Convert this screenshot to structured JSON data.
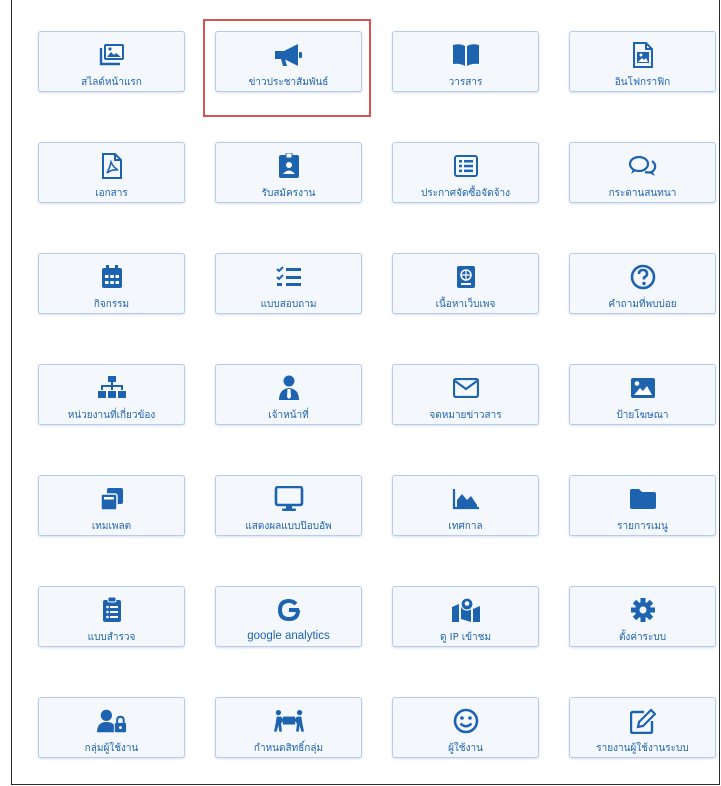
{
  "accent_color": "#1e63b0",
  "highlight_color": "#d9534f",
  "tiles": [
    {
      "label": "สไลด์หน้าแรก",
      "icon": "images-icon"
    },
    {
      "label": "ข่าวประชาสัมพันธ์",
      "icon": "megaphone-icon",
      "highlighted": true
    },
    {
      "label": "วารสาร",
      "icon": "book-open-icon"
    },
    {
      "label": "อินโฟกราฟิก",
      "icon": "file-image-icon"
    },
    {
      "label": "เอกสาร",
      "icon": "file-pdf-icon"
    },
    {
      "label": "รับสมัครงาน",
      "icon": "id-badge-icon"
    },
    {
      "label": "ประกาศจัดซื้อจัดจ้าง",
      "icon": "list-alt-icon"
    },
    {
      "label": "กระดานสนทนา",
      "icon": "comments-icon"
    },
    {
      "label": "กิจกรรม",
      "icon": "calendar-icon"
    },
    {
      "label": "แบบสอบถาม",
      "icon": "tasks-icon"
    },
    {
      "label": "เนื้อหาเว็บเพจ",
      "icon": "passport-icon"
    },
    {
      "label": "คำถามที่พบบ่อย",
      "icon": "question-circle-icon"
    },
    {
      "label": "หน่วยงานที่เกี่ยวข้อง",
      "icon": "sitemap-icon"
    },
    {
      "label": "เจ้าหน้าที่",
      "icon": "user-tie-icon"
    },
    {
      "label": "จดหมายข่าวสาร",
      "icon": "envelope-icon"
    },
    {
      "label": "ป้ายโฆษณา",
      "icon": "image-icon"
    },
    {
      "label": "เทมเพลต",
      "icon": "clone-icon"
    },
    {
      "label": "แสดงผลแบบป๊อบอัพ",
      "icon": "desktop-icon"
    },
    {
      "label": "เทศกาล",
      "icon": "chart-area-icon"
    },
    {
      "label": "รายการเมนู",
      "icon": "folder-icon"
    },
    {
      "label": "แบบสำรวจ",
      "icon": "clipboard-list-icon"
    },
    {
      "label": "google analytics",
      "icon": "google-icon",
      "latin": true
    },
    {
      "label": "ดู IP เข้าชม",
      "icon": "map-marked-icon"
    },
    {
      "label": "ตั้งค่าระบบ",
      "icon": "cog-icon"
    },
    {
      "label": "กลุ่มผู้ใช้งาน",
      "icon": "user-lock-icon"
    },
    {
      "label": "กำหนดสิทธิ์กลุ่ม",
      "icon": "people-carry-icon"
    },
    {
      "label": "ผู้ใช้งาน",
      "icon": "smile-icon"
    },
    {
      "label": "รายงานผู้ใช้งานระบบ",
      "icon": "edit-icon"
    }
  ]
}
